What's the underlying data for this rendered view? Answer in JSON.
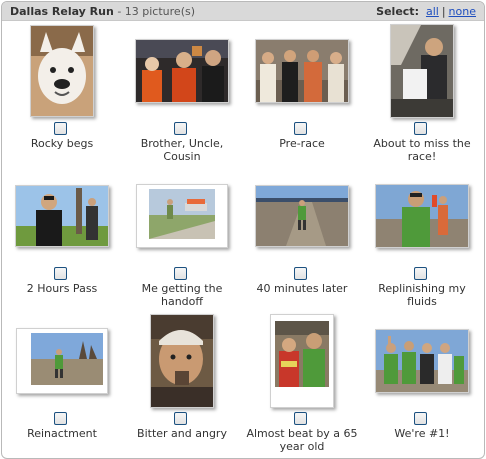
{
  "header": {
    "album_title": "Dallas Relay Run",
    "picture_count": "- 13 picture(s)",
    "select_label": "Select:",
    "select_all": "all",
    "select_separator": "|",
    "select_none": "none"
  },
  "photos": [
    {
      "caption": "Rocky begs"
    },
    {
      "caption": "Brother, Uncle, Cousin"
    },
    {
      "caption": "Pre-race"
    },
    {
      "caption": "About to miss the race!"
    },
    {
      "caption": "2 Hours Pass"
    },
    {
      "caption": "Me getting the handoff"
    },
    {
      "caption": "40 minutes later"
    },
    {
      "caption": "Replinishing my fluids"
    },
    {
      "caption": "Reinactment"
    },
    {
      "caption": "Bitter and angry"
    },
    {
      "caption": "Almost beat by a 65 year old"
    },
    {
      "caption": "We're #1!"
    }
  ],
  "colors": {
    "header_bg": "#d9d9d9",
    "link": "#1f4fbf",
    "checkbox_border": "#1c5180"
  }
}
